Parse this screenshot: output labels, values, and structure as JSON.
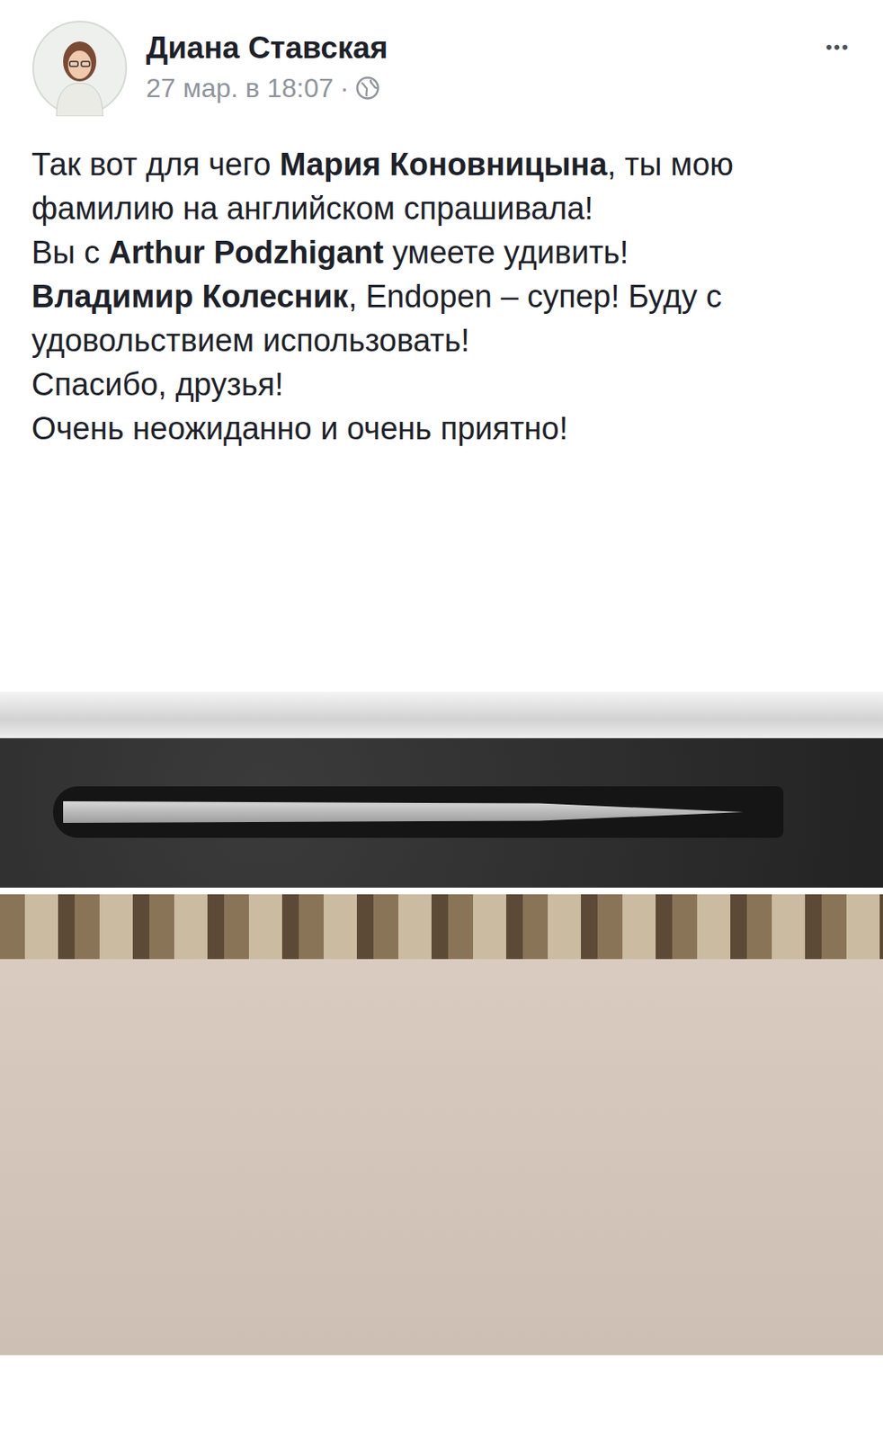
{
  "author": {
    "name": "Диана Ставская"
  },
  "meta": {
    "time": "27 мар. в 18:07",
    "separator": "·"
  },
  "menu": "•••",
  "post": {
    "lines": [
      {
        "segments": [
          {
            "text": "Так вот для чего ",
            "bold": false
          },
          {
            "text": "Мария Коновницына",
            "bold": true
          },
          {
            "text": ", ты мою фамилию на английском спрашивала!",
            "bold": false
          }
        ]
      },
      {
        "segments": [
          {
            "text": "Вы с ",
            "bold": false
          },
          {
            "text": "Arthur Podzhigant",
            "bold": true
          },
          {
            "text": " умеете удивить!",
            "bold": false
          }
        ]
      },
      {
        "segments": [
          {
            "text": "Владимир Колесник",
            "bold": true
          },
          {
            "text": ", Endopen – супер! Буду с удовольствием использовать!",
            "bold": false
          }
        ]
      },
      {
        "segments": [
          {
            "text": "Спасибо, друзья!",
            "bold": false
          }
        ]
      },
      {
        "segments": [
          {
            "text": "Очень неожиданно и очень приятно!",
            "bold": false
          }
        ]
      }
    ]
  }
}
